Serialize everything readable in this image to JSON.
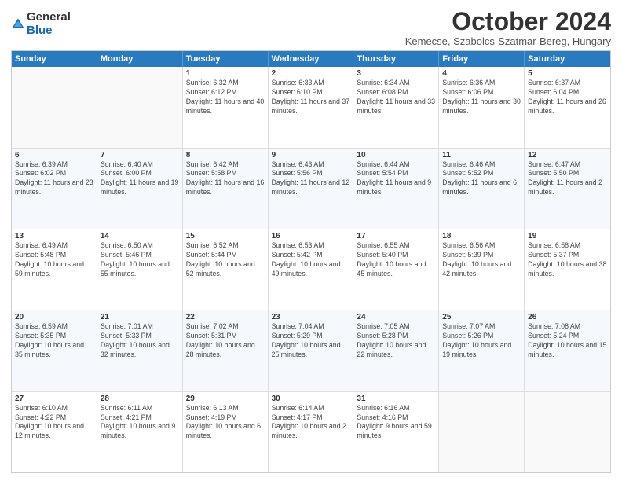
{
  "logo": {
    "general": "General",
    "blue": "Blue"
  },
  "title": "October 2024",
  "subtitle": "Kemecse, Szabolcs-Szatmar-Bereg, Hungary",
  "headers": [
    "Sunday",
    "Monday",
    "Tuesday",
    "Wednesday",
    "Thursday",
    "Friday",
    "Saturday"
  ],
  "weeks": [
    [
      {
        "day": "",
        "text": ""
      },
      {
        "day": "",
        "text": ""
      },
      {
        "day": "1",
        "text": "Sunrise: 6:32 AM\nSunset: 6:12 PM\nDaylight: 11 hours and 40 minutes."
      },
      {
        "day": "2",
        "text": "Sunrise: 6:33 AM\nSunset: 6:10 PM\nDaylight: 11 hours and 37 minutes."
      },
      {
        "day": "3",
        "text": "Sunrise: 6:34 AM\nSunset: 6:08 PM\nDaylight: 11 hours and 33 minutes."
      },
      {
        "day": "4",
        "text": "Sunrise: 6:36 AM\nSunset: 6:06 PM\nDaylight: 11 hours and 30 minutes."
      },
      {
        "day": "5",
        "text": "Sunrise: 6:37 AM\nSunset: 6:04 PM\nDaylight: 11 hours and 26 minutes."
      }
    ],
    [
      {
        "day": "6",
        "text": "Sunrise: 6:39 AM\nSunset: 6:02 PM\nDaylight: 11 hours and 23 minutes."
      },
      {
        "day": "7",
        "text": "Sunrise: 6:40 AM\nSunset: 6:00 PM\nDaylight: 11 hours and 19 minutes."
      },
      {
        "day": "8",
        "text": "Sunrise: 6:42 AM\nSunset: 5:58 PM\nDaylight: 11 hours and 16 minutes."
      },
      {
        "day": "9",
        "text": "Sunrise: 6:43 AM\nSunset: 5:56 PM\nDaylight: 11 hours and 12 minutes."
      },
      {
        "day": "10",
        "text": "Sunrise: 6:44 AM\nSunset: 5:54 PM\nDaylight: 11 hours and 9 minutes."
      },
      {
        "day": "11",
        "text": "Sunrise: 6:46 AM\nSunset: 5:52 PM\nDaylight: 11 hours and 6 minutes."
      },
      {
        "day": "12",
        "text": "Sunrise: 6:47 AM\nSunset: 5:50 PM\nDaylight: 11 hours and 2 minutes."
      }
    ],
    [
      {
        "day": "13",
        "text": "Sunrise: 6:49 AM\nSunset: 5:48 PM\nDaylight: 10 hours and 59 minutes."
      },
      {
        "day": "14",
        "text": "Sunrise: 6:50 AM\nSunset: 5:46 PM\nDaylight: 10 hours and 55 minutes."
      },
      {
        "day": "15",
        "text": "Sunrise: 6:52 AM\nSunset: 5:44 PM\nDaylight: 10 hours and 52 minutes."
      },
      {
        "day": "16",
        "text": "Sunrise: 6:53 AM\nSunset: 5:42 PM\nDaylight: 10 hours and 49 minutes."
      },
      {
        "day": "17",
        "text": "Sunrise: 6:55 AM\nSunset: 5:40 PM\nDaylight: 10 hours and 45 minutes."
      },
      {
        "day": "18",
        "text": "Sunrise: 6:56 AM\nSunset: 5:39 PM\nDaylight: 10 hours and 42 minutes."
      },
      {
        "day": "19",
        "text": "Sunrise: 6:58 AM\nSunset: 5:37 PM\nDaylight: 10 hours and 38 minutes."
      }
    ],
    [
      {
        "day": "20",
        "text": "Sunrise: 6:59 AM\nSunset: 5:35 PM\nDaylight: 10 hours and 35 minutes."
      },
      {
        "day": "21",
        "text": "Sunrise: 7:01 AM\nSunset: 5:33 PM\nDaylight: 10 hours and 32 minutes."
      },
      {
        "day": "22",
        "text": "Sunrise: 7:02 AM\nSunset: 5:31 PM\nDaylight: 10 hours and 28 minutes."
      },
      {
        "day": "23",
        "text": "Sunrise: 7:04 AM\nSunset: 5:29 PM\nDaylight: 10 hours and 25 minutes."
      },
      {
        "day": "24",
        "text": "Sunrise: 7:05 AM\nSunset: 5:28 PM\nDaylight: 10 hours and 22 minutes."
      },
      {
        "day": "25",
        "text": "Sunrise: 7:07 AM\nSunset: 5:26 PM\nDaylight: 10 hours and 19 minutes."
      },
      {
        "day": "26",
        "text": "Sunrise: 7:08 AM\nSunset: 5:24 PM\nDaylight: 10 hours and 15 minutes."
      }
    ],
    [
      {
        "day": "27",
        "text": "Sunrise: 6:10 AM\nSunset: 4:22 PM\nDaylight: 10 hours and 12 minutes."
      },
      {
        "day": "28",
        "text": "Sunrise: 6:11 AM\nSunset: 4:21 PM\nDaylight: 10 hours and 9 minutes."
      },
      {
        "day": "29",
        "text": "Sunrise: 6:13 AM\nSunset: 4:19 PM\nDaylight: 10 hours and 6 minutes."
      },
      {
        "day": "30",
        "text": "Sunrise: 6:14 AM\nSunset: 4:17 PM\nDaylight: 10 hours and 2 minutes."
      },
      {
        "day": "31",
        "text": "Sunrise: 6:16 AM\nSunset: 4:16 PM\nDaylight: 9 hours and 59 minutes."
      },
      {
        "day": "",
        "text": ""
      },
      {
        "day": "",
        "text": ""
      }
    ]
  ]
}
